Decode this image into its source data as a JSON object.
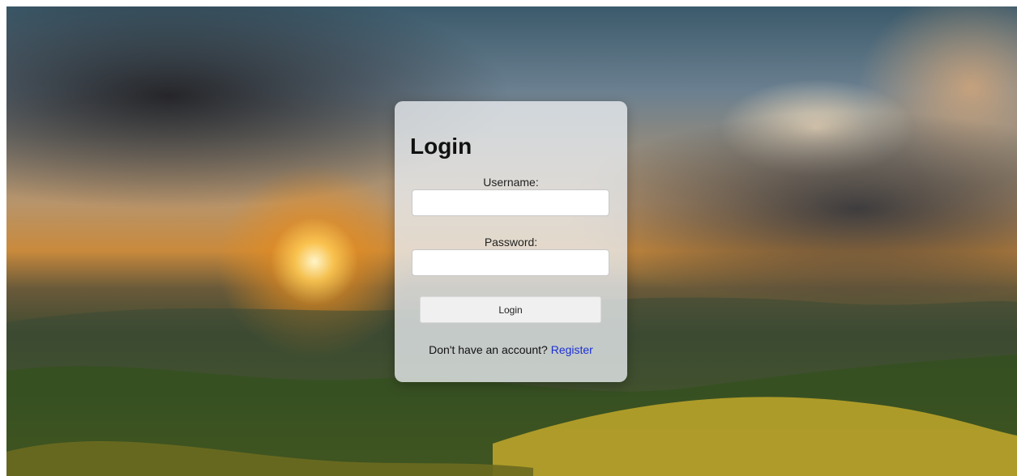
{
  "login": {
    "title": "Login",
    "username_label": "Username:",
    "username_value": "",
    "password_label": "Password:",
    "password_value": "",
    "submit_label": "Login",
    "footer_text": "Don't have an account?",
    "register_link": "Register"
  },
  "colors": {
    "link": "#1a2fd6",
    "card_bg": "#ebeef2",
    "button_bg": "#f0f0f0"
  }
}
